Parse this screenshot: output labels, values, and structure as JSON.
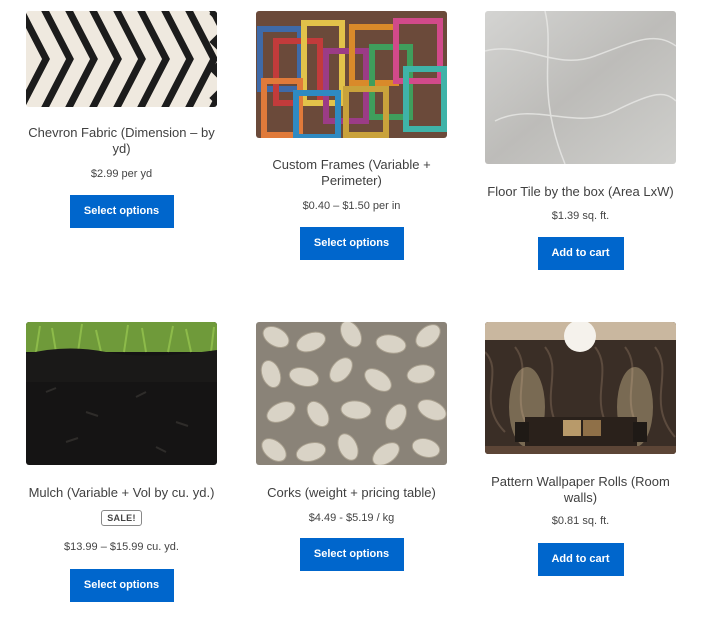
{
  "products": [
    {
      "title": "Chevron Fabric (Dimension – by yd)",
      "price": "$2.99 per yd",
      "button": "Select options",
      "image": "chevron-fabric"
    },
    {
      "title": "Custom Frames (Variable + Perimeter)",
      "price": "$0.40 – $1.50 per in",
      "button": "Select options",
      "image": "picture-frames"
    },
    {
      "title": "Floor Tile by the box (Area LxW)",
      "price": "$1.39 sq. ft.",
      "button": "Add to cart",
      "image": "marble-tile"
    },
    {
      "title": "Mulch (Variable + Vol by cu. yd.)",
      "sale": "SALE!",
      "price": "$13.99 – $15.99 cu. yd.",
      "button": "Select options",
      "image": "mulch"
    },
    {
      "title": "Corks (weight + pricing table)",
      "price": "$4.49 - $5.19 / kg",
      "button": "Select options",
      "image": "corks"
    },
    {
      "title": "Pattern Wallpaper Rolls (Room walls)",
      "price": "$0.81 sq. ft.",
      "button": "Add to cart",
      "image": "wallpaper-room"
    }
  ],
  "colors": {
    "button": "#0066cc",
    "button_text": "#ffffff"
  }
}
